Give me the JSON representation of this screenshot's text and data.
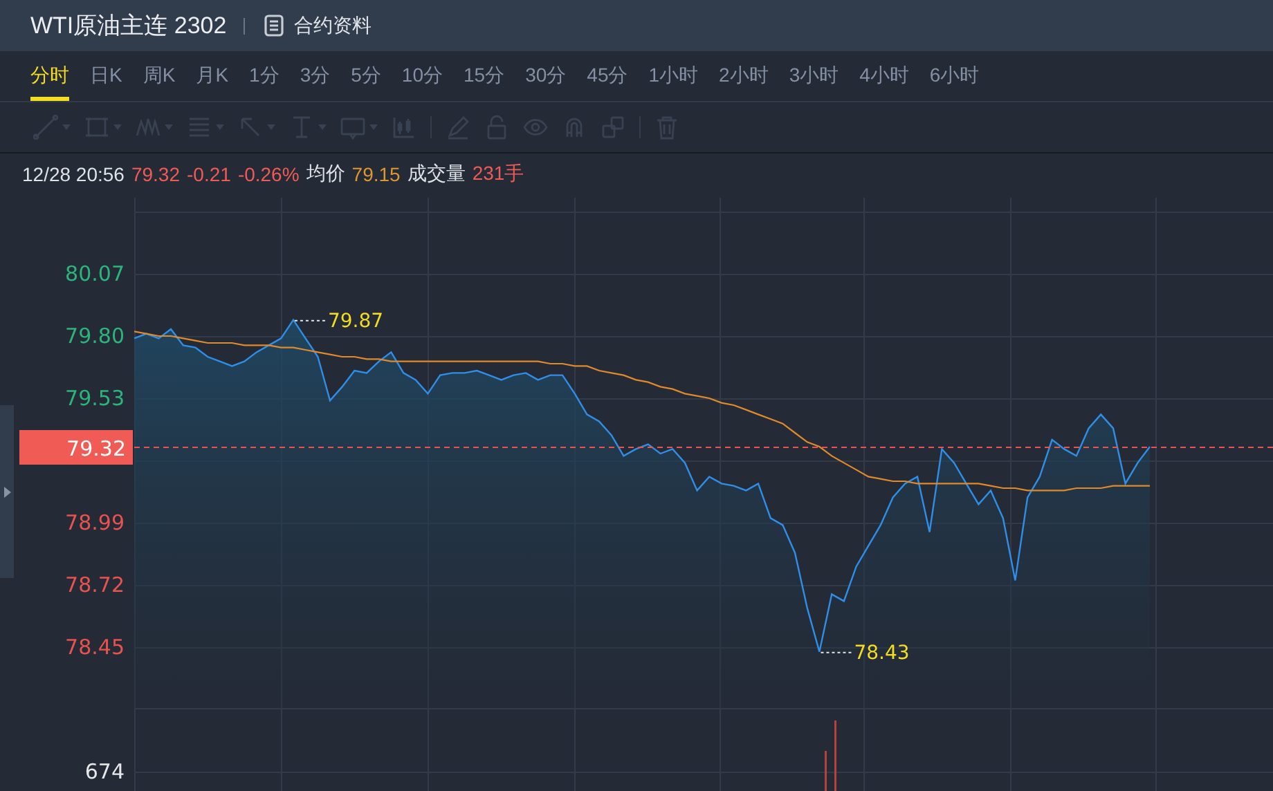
{
  "header": {
    "title": "WTI原油主连 2302",
    "link": "合约资料"
  },
  "periods": [
    {
      "label": "分时",
      "selected": true
    },
    {
      "label": "日K",
      "selected": false
    },
    {
      "label": "周K",
      "selected": false
    },
    {
      "label": "月K",
      "selected": false
    },
    {
      "label": "1分",
      "selected": false
    },
    {
      "label": "3分",
      "selected": false
    },
    {
      "label": "5分",
      "selected": false
    },
    {
      "label": "10分",
      "selected": false
    },
    {
      "label": "15分",
      "selected": false
    },
    {
      "label": "30分",
      "selected": false
    },
    {
      "label": "45分",
      "selected": false
    },
    {
      "label": "1小时",
      "selected": false
    },
    {
      "label": "2小时",
      "selected": false
    },
    {
      "label": "3小时",
      "selected": false
    },
    {
      "label": "4小时",
      "selected": false
    },
    {
      "label": "6小时",
      "selected": false
    }
  ],
  "tools": [
    {
      "kind": "line",
      "caret": true,
      "disabled": true
    },
    {
      "kind": "rect",
      "caret": true,
      "disabled": true
    },
    {
      "kind": "wave",
      "caret": true,
      "disabled": true
    },
    {
      "kind": "lines",
      "caret": true,
      "disabled": true
    },
    {
      "kind": "arrow",
      "caret": true,
      "disabled": true
    },
    {
      "kind": "textcursor",
      "caret": true,
      "disabled": true
    },
    {
      "kind": "label",
      "caret": true,
      "disabled": true
    },
    {
      "kind": "candles",
      "caret": false,
      "disabled": true
    },
    {
      "kind": "sep"
    },
    {
      "kind": "pencil",
      "caret": false,
      "disabled": true
    },
    {
      "kind": "lock",
      "caret": false,
      "disabled": true
    },
    {
      "kind": "eye",
      "caret": false,
      "disabled": true
    },
    {
      "kind": "magnet",
      "caret": false,
      "disabled": true
    },
    {
      "kind": "copy",
      "caret": false,
      "disabled": true
    },
    {
      "kind": "sep"
    },
    {
      "kind": "trash",
      "caret": false,
      "disabled": true
    }
  ],
  "quote": {
    "time": "12/28 20:56",
    "price": "79.32",
    "change": "-0.21",
    "percent": "-0.26%",
    "avg_label": "均价",
    "avg": "79.15",
    "volume_label": "成交量",
    "volume": "231手"
  },
  "chart": {
    "high_label": "79.87",
    "low_label": "78.43",
    "chart_data": {
      "type": "area",
      "grid": true,
      "ylim": [
        78.18,
        80.4
      ],
      "ref_lines": [
        {
          "axis": "y",
          "value": 79.32,
          "label": "79.32"
        }
      ],
      "yticks": [
        {
          "value": 80.07,
          "label": "80.07"
        },
        {
          "value": 79.8,
          "label": "79.80"
        },
        {
          "value": 79.53,
          "label": "79.53"
        },
        {
          "value": 78.99,
          "label": "78.99"
        },
        {
          "value": 78.72,
          "label": "78.72"
        },
        {
          "value": 78.45,
          "label": "78.45"
        }
      ],
      "categories": [
        null,
        null,
        null,
        null,
        null,
        null,
        null,
        null,
        null,
        null,
        null,
        null,
        null,
        null,
        null,
        null,
        null,
        null,
        null,
        null,
        null,
        null,
        null,
        null,
        null,
        null,
        null,
        null,
        null,
        null,
        null,
        null,
        null,
        null,
        null,
        null,
        null,
        null,
        null,
        null,
        null,
        null,
        null,
        null,
        null,
        null,
        null,
        null,
        null,
        null,
        null,
        null,
        null,
        null,
        null,
        null,
        null,
        null,
        null,
        null,
        null,
        null,
        null,
        null,
        null,
        null,
        null,
        null,
        null,
        null,
        null,
        null,
        null,
        null,
        null,
        null,
        null,
        null,
        null,
        null,
        null,
        null,
        null,
        null
      ],
      "series": [
        {
          "color": "#2f8fe8",
          "values": [
            79.79,
            79.81,
            79.79,
            79.83,
            79.76,
            79.75,
            79.71,
            79.69,
            79.67,
            79.69,
            79.73,
            79.76,
            79.79,
            79.87,
            79.79,
            79.71,
            79.52,
            79.58,
            79.65,
            79.64,
            79.69,
            79.73,
            79.64,
            79.61,
            79.55,
            79.63,
            79.64,
            79.64,
            79.65,
            79.63,
            79.61,
            79.63,
            79.64,
            79.61,
            79.63,
            79.63,
            79.55,
            79.46,
            79.43,
            79.37,
            79.28,
            79.31,
            79.33,
            79.29,
            79.31,
            79.25,
            79.13,
            79.19,
            79.16,
            79.15,
            79.13,
            79.16,
            79.01,
            78.98,
            78.86,
            78.62,
            78.43,
            78.68,
            78.65,
            78.8,
            78.89,
            78.98,
            79.1,
            79.16,
            79.19,
            78.95,
            79.31,
            79.25,
            79.16,
            79.07,
            79.13,
            79.01,
            78.74,
            79.1,
            79.19,
            79.35,
            79.31,
            79.28,
            79.4,
            79.46,
            79.4,
            79.16,
            79.25,
            79.32
          ]
        },
        {
          "type": "line",
          "color": "#e08a2c",
          "values": [
            79.82,
            79.81,
            79.8,
            79.8,
            79.79,
            79.78,
            79.77,
            79.77,
            79.77,
            79.76,
            79.76,
            79.76,
            79.75,
            79.75,
            79.74,
            79.73,
            79.72,
            79.71,
            79.71,
            79.7,
            79.7,
            79.69,
            79.69,
            79.69,
            79.69,
            79.69,
            79.69,
            79.69,
            79.69,
            79.69,
            79.69,
            79.69,
            79.69,
            79.69,
            79.68,
            79.68,
            79.67,
            79.67,
            79.65,
            79.64,
            79.63,
            79.61,
            79.6,
            79.58,
            79.57,
            79.55,
            79.54,
            79.53,
            79.51,
            79.5,
            79.48,
            79.46,
            79.44,
            79.42,
            79.38,
            79.34,
            79.32,
            79.28,
            79.25,
            79.22,
            79.19,
            79.18,
            79.17,
            79.17,
            79.16,
            79.16,
            79.16,
            79.16,
            79.16,
            79.16,
            79.15,
            79.14,
            79.14,
            79.13,
            79.13,
            79.13,
            79.13,
            79.14,
            79.14,
            79.14,
            79.15,
            79.15,
            79.15,
            79.15
          ]
        }
      ]
    },
    "volume_label": "674"
  }
}
